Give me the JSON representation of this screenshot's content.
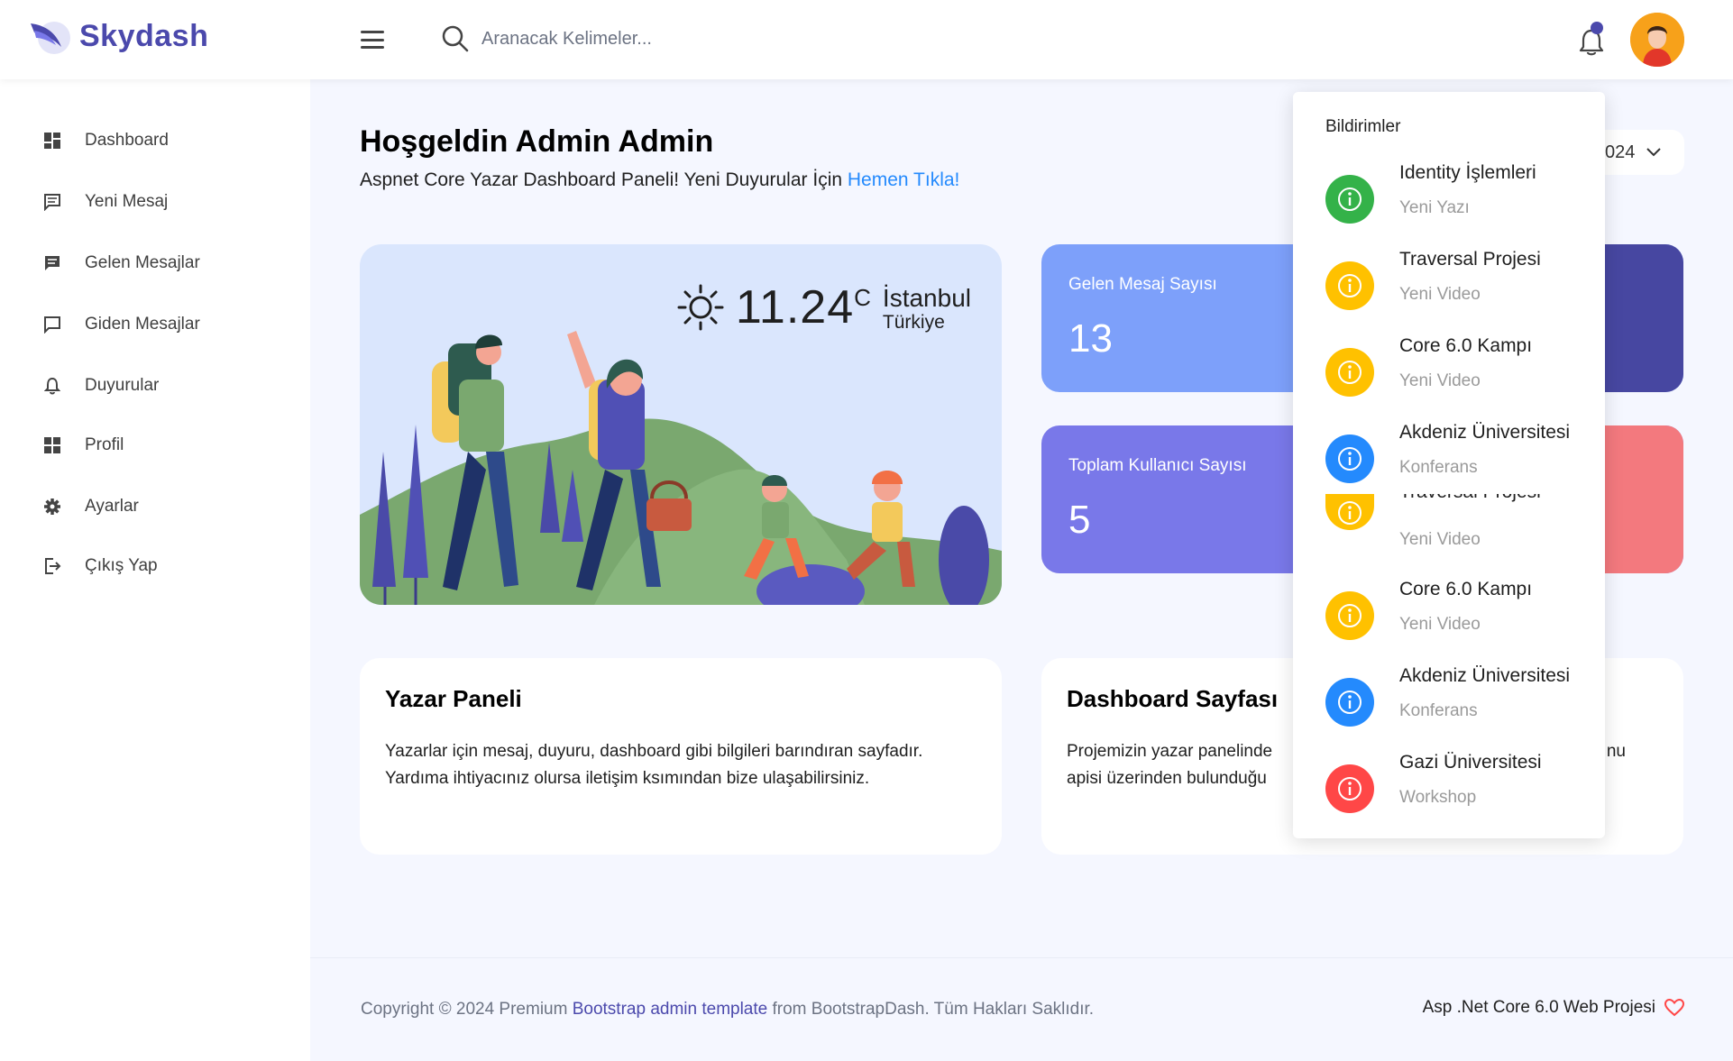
{
  "brand": {
    "name": "Skydash"
  },
  "search": {
    "placeholder": "Aranacak Kelimeler..."
  },
  "sidebar": {
    "items": [
      {
        "label": "Dashboard",
        "icon": "dashboard-icon"
      },
      {
        "label": "Yeni Mesaj",
        "icon": "message-icon"
      },
      {
        "label": "Gelen Mesajlar",
        "icon": "inbox-icon"
      },
      {
        "label": "Giden Mesajlar",
        "icon": "outbox-icon"
      },
      {
        "label": "Duyurular",
        "icon": "bell-icon"
      },
      {
        "label": "Profil",
        "icon": "profile-icon"
      },
      {
        "label": "Ayarlar",
        "icon": "gear-icon"
      },
      {
        "label": "Çıkış Yap",
        "icon": "logout-icon"
      }
    ]
  },
  "welcome": {
    "title": "Hoşgeldin Admin Admin",
    "subtitle": "Aspnet Core Yazar Dashboard Paneli! Yeni Duyurular İçin ",
    "link": "Hemen Tıkla!"
  },
  "date_pill": {
    "text": "024"
  },
  "weather": {
    "temperature": "11.24",
    "unit": "C",
    "city": "İstanbul",
    "country": "Türkiye",
    "icon": "sun-icon"
  },
  "stats": [
    {
      "label": "Gelen Mesaj Sayısı",
      "value": "13",
      "color": "#7da0fa"
    },
    {
      "label": "Toplam Kullanıcı Sayısı",
      "value": "5",
      "color": "#7978e9"
    },
    {
      "color": "#4747a1"
    },
    {
      "color": "#f3797e"
    }
  ],
  "cards": [
    {
      "title": "Yazar Paneli",
      "body": "Yazarlar için mesaj, duyuru, dashboard gibi bilgileri barındıran sayfadır. Yardıma ihtiyacınız olursa iletişim ksımından bize ulaşabilirsiniz."
    },
    {
      "title": "Dashboard Sayfası",
      "body_line1": "Projemizin yazar panelinde",
      "body_line1_end": "nu",
      "body_line2": "apisi üzerinden bulunduğu"
    }
  ],
  "notifications": {
    "title": "Bildirimler",
    "items": [
      {
        "title": "Identity İşlemleri",
        "sub": "Yeni Yazı",
        "color": "#34b249"
      },
      {
        "title": "Traversal Projesi",
        "sub": "Yeni Video",
        "color": "#ffc100"
      },
      {
        "title": "Core 6.0 Kampı",
        "sub": "Yeni Video",
        "color": "#ffc100"
      },
      {
        "title": "Akdeniz Üniversitesi",
        "sub": "Konferans",
        "color": "#248afd"
      },
      {
        "title": "Traversal Projesi",
        "sub": "Yeni Video",
        "color": "#ffc100"
      },
      {
        "title": "Core 6.0 Kampı",
        "sub": "Yeni Video",
        "color": "#ffc100"
      },
      {
        "title": "Akdeniz Üniversitesi",
        "sub": "Konferans",
        "color": "#248afd"
      },
      {
        "title": "Gazi Üniversitesi",
        "sub": "Workshop",
        "color": "#ff4747"
      }
    ]
  },
  "footer": {
    "prefix": "Copyright © 2024 Premium ",
    "link": "Bootstrap admin template",
    "suffix": " from BootstrapDash. Tüm Hakları Saklıdır.",
    "right": "Asp .Net Core 6.0 Web Projesi",
    "heart_icon": "heart-icon"
  }
}
